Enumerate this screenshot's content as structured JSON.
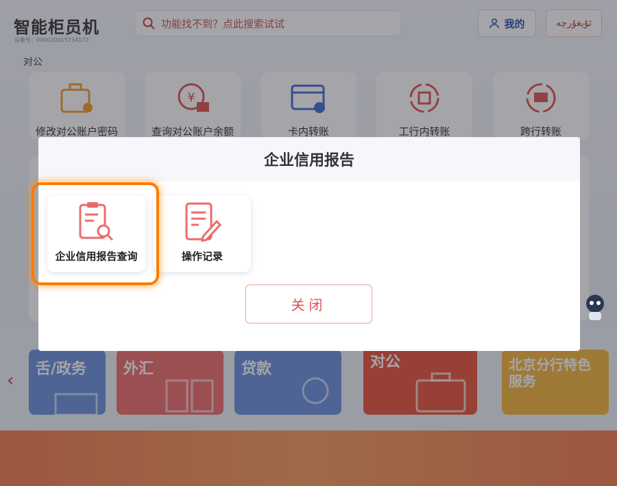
{
  "header": {
    "app_title": "智能柜员机",
    "device_no": "设备号：000020015734172",
    "search_placeholder": "功能找不到？点此搜索试试",
    "mine_label": "我的",
    "lang_label": "ئۇيغۇرچە"
  },
  "section": {
    "label": "对公"
  },
  "tiles": [
    {
      "label": "修改对公账户密码",
      "icon": "briefcase-gear-icon"
    },
    {
      "label": "查询对公账户余额",
      "icon": "yuan-coin-icon"
    },
    {
      "label": "卡内转账",
      "icon": "card-transfer-icon"
    },
    {
      "label": "工行内转账",
      "icon": "icbc-transfer-icon"
    },
    {
      "label": "跨行转账",
      "icon": "card-cycle-icon"
    }
  ],
  "categories": [
    {
      "label": "舌/政务",
      "color": "#5f86d8"
    },
    {
      "label": "外汇",
      "color": "#ef6b6b"
    },
    {
      "label": "贷款",
      "color": "#6a8fdc"
    },
    {
      "label": "对公",
      "color": "#e8523a"
    },
    {
      "label": "北京分行特色服务",
      "color": "#f5b53a"
    }
  ],
  "modal": {
    "title": "企业信用报告",
    "options": [
      {
        "label": "企业信用报告查询",
        "icon": "report-search-icon"
      },
      {
        "label": "操作记录",
        "icon": "document-edit-icon"
      }
    ],
    "close_label": "关闭"
  },
  "colors": {
    "accent": "#e05050",
    "highlight": "#ff7a00",
    "brand_blue": "#2a4fb0"
  }
}
